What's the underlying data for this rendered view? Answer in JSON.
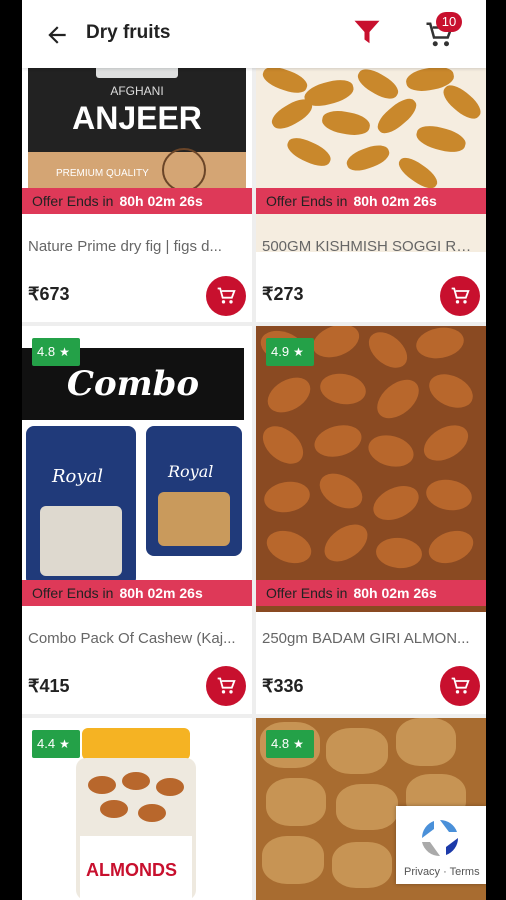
{
  "header": {
    "title": "Dry fruits",
    "cart_count": "10",
    "icons": [
      "back-arrow-icon",
      "filter-icon",
      "cart-icon"
    ]
  },
  "offer": {
    "label": "Offer Ends in",
    "time": "80h 02m 26s"
  },
  "products": [
    {
      "name": "Nature Prime dry fig | figs d...",
      "price": "₹673",
      "rating": null
    },
    {
      "name": "500GM KISHMISH SOGGI RAI...",
      "price": "₹273",
      "rating": null
    },
    {
      "name": "Combo Pack Of Cashew (Kaj...",
      "price": "₹415",
      "rating": "4.8"
    },
    {
      "name": "250gm BADAM GIRI ALMON...",
      "price": "₹336",
      "rating": "4.9"
    },
    {
      "name": "",
      "price": "",
      "rating": "4.4"
    },
    {
      "name": "",
      "price": "",
      "rating": "4.8"
    }
  ],
  "images": {
    "fig_jar": {
      "brand": "AFGHANI",
      "product": "ANJEER",
      "tag": "PREMIUM QUALITY"
    },
    "combo": {
      "banner": "Combo offer",
      "pouch_brand": "Royal"
    },
    "almond_jar": {
      "label": "ALMONDS"
    }
  },
  "recaptcha": {
    "text": "Privacy · Terms"
  },
  "colors": {
    "accent": "#c8102e",
    "offer": "#de3958",
    "rating": "#24a148"
  }
}
